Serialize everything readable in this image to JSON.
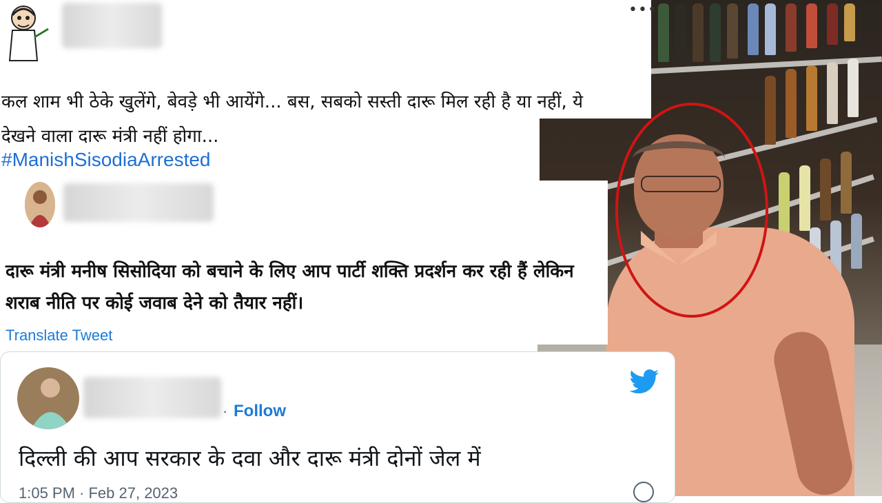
{
  "tweet1": {
    "text_line1": "कल शाम भी ठेके खुलेंगे, बेवड़े भी आयेंगे... बस, सबको सस्ती दारू मिल रही है या नहीं, ये",
    "text_line2": "देखने वाला दारू मंत्री नहीं होगा...",
    "hashtag": "#ManishSisodiaArrested",
    "more_label": "•••"
  },
  "tweet2": {
    "text_line1": "दारू मंत्री मनीष सिसोदिया को बचाने के लिए आप पार्टी शक्ति प्रदर्शन कर रही हैं लेकिन",
    "text_line2": "शराब नीति पर कोई जवाब देने को तैयार नहीं।",
    "translate_label": "Translate Tweet"
  },
  "tweet3": {
    "separator": "·",
    "follow_label": "Follow",
    "text": "दिल्ली की आप सरकार के दवा और दारू मंत्री दोनों जेल में",
    "timestamp": "1:05 PM · Feb 27, 2023",
    "icon": "twitter-bird-icon",
    "info_icon": "info-icon"
  },
  "colors": {
    "link_blue": "#1d7bd6",
    "twitter_blue": "#1d9bf0",
    "highlight_red": "#d01414"
  }
}
